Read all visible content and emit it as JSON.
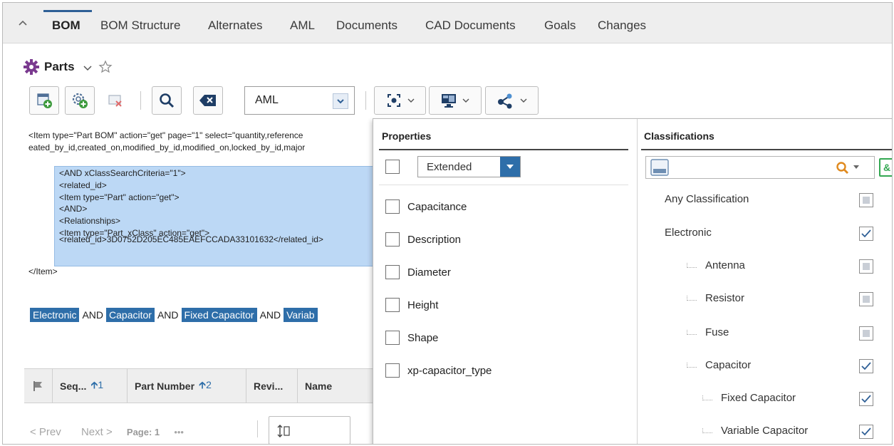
{
  "tabs": [
    {
      "label": "BOM",
      "active": true
    },
    {
      "label": "BOM Structure"
    },
    {
      "label": "Alternates"
    },
    {
      "label": "AML"
    },
    {
      "label": "Documents"
    },
    {
      "label": "CAD Documents"
    },
    {
      "label": "Goals"
    },
    {
      "label": "Changes"
    }
  ],
  "header": {
    "title": "Parts"
  },
  "toolbar": {
    "query_type": "AML"
  },
  "aml": {
    "lines_top": [
      "<Item type=\"Part BOM\" action=\"get\" page=\"1\" select=\"quantity,reference",
      "eated_by_id,created_on,modified_by_id,modified_on,locked_by_id,major"
    ],
    "lines_highlighted": [
      "<AND xClassSearchCriteria=\"1\">",
      "<related_id>",
      "<Item type=\"Part\" action=\"get\">",
      "<AND>",
      "<Relationships>",
      "<Item type=\"Part_xClass\" action=\"get\">",
      "<related_id>3D0752D205EC485EAEFCCADA33101632</related_id>"
    ],
    "line_end": "</Item>"
  },
  "criteria": {
    "chips": [
      "Electronic",
      "Capacitor",
      "Fixed Capacitor",
      "Variab"
    ],
    "joiner": "AND"
  },
  "grid": {
    "columns": [
      {
        "label": "Seq...",
        "sort": "1"
      },
      {
        "label": "Part Number",
        "sort": "2"
      },
      {
        "label": "Revi..."
      },
      {
        "label": "Name"
      }
    ]
  },
  "pager": {
    "prev": "< Prev",
    "next": "Next >",
    "page": "Page: 1",
    "more": "•••"
  },
  "panel": {
    "properties": {
      "title": "Properties",
      "mode": "Extended",
      "items": [
        "Capacitance",
        "Description",
        "Diameter",
        "Height",
        "Shape",
        "xp-capacitor_type"
      ]
    },
    "classifications": {
      "title": "Classifications",
      "items": [
        {
          "label": "Any Classification",
          "state": "partial",
          "depth": 0
        },
        {
          "label": "Electronic",
          "state": "checked",
          "depth": 0
        },
        {
          "label": "Antenna",
          "state": "partial",
          "depth": 1
        },
        {
          "label": "Resistor",
          "state": "partial",
          "depth": 1
        },
        {
          "label": "Fuse",
          "state": "partial",
          "depth": 1
        },
        {
          "label": "Capacitor",
          "state": "checked",
          "depth": 1
        },
        {
          "label": "Fixed Capacitor",
          "state": "checked",
          "depth": 2
        },
        {
          "label": "Variable Capacitor",
          "state": "checked",
          "depth": 2
        }
      ]
    }
  },
  "colors": {
    "accent": "#2e6ea9",
    "chip_bg": "#2e6ea9",
    "highlight": "#bcd8f5",
    "logical_and": "#33a852",
    "search_orange": "#e08a1e"
  }
}
